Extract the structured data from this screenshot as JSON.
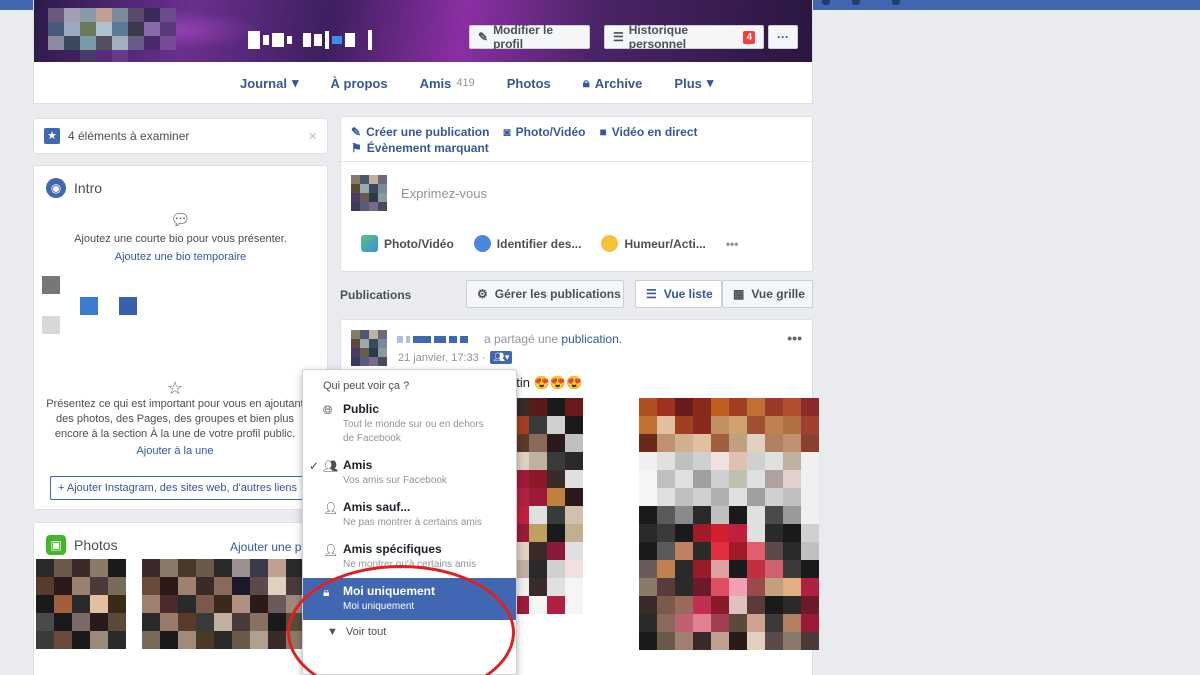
{
  "cover": {
    "edit_profile_label": "Modifier le profil",
    "activity_log_label": "Historique personnel",
    "activity_count": "4",
    "more_label": "···"
  },
  "tabs": [
    {
      "label": "Journal",
      "chevron": "▾"
    },
    {
      "label": "À propos"
    },
    {
      "label": "Amis",
      "count": "419"
    },
    {
      "label": "Photos"
    },
    {
      "label": "Archive",
      "icon": "lock-icon"
    },
    {
      "label": "Plus",
      "chevron": "▾"
    }
  ],
  "notice": {
    "text": "4 éléments à examiner",
    "close": "×"
  },
  "intro": {
    "title": "Intro",
    "bio_prompt": "Ajoutez une courte bio pour vous présenter.",
    "temp_bio_link": "Ajoutez une bio temporaire",
    "featured_text": "Présentez ce qui est important pour vous en ajoutant des photos, des Pages, des groupes et bien plus encore à la section À la une de votre profil public.",
    "featured_link": "Ajouter à la une",
    "add_links_button": "+ Ajouter Instagram, des sites web, d'autres liens"
  },
  "photos": {
    "title": "Photos",
    "add_link": "Ajouter une photo"
  },
  "compose": {
    "create_post": "Créer une publication",
    "photo_video": "Photo/Vidéo",
    "live_video": "Vidéo en direct",
    "life_event": "Évènement marquant",
    "placeholder": "Exprimez-vous",
    "action_photo": "Photo/Vidéo",
    "action_tag": "Identifier des...",
    "action_feeling": "Humeur/Acti...",
    "action_more": "•••"
  },
  "publications": {
    "label": "Publications",
    "manage_label": "Gérer les publications",
    "list_view_label": "Vue liste",
    "grid_view_label": "Vue grille"
  },
  "post": {
    "shared_text": "a partagé une",
    "shared_link": "publication.",
    "date": "21 janvier, 17:33 ·",
    "body_text": "ntin 😍😍😍",
    "more": "•••"
  },
  "privacy_menu": {
    "heading": "Qui peut voir ça ?",
    "options": [
      {
        "title": "Public",
        "desc": "Tout le monde sur ou en dehors de Facebook",
        "icon": "globe-icon",
        "checked": false
      },
      {
        "title": "Amis",
        "desc": "Vos amis sur Facebook",
        "icon": "friends-icon",
        "checked": true
      },
      {
        "title": "Amis sauf...",
        "desc": "Ne pas montrer à certains amis",
        "icon": "person-minus-icon",
        "checked": false
      },
      {
        "title": "Amis spécifiques",
        "desc": "Ne montrer qu'à certains amis",
        "icon": "person-icon",
        "checked": false
      },
      {
        "title": "Moi uniquement",
        "desc": "Moi uniquement",
        "icon": "lock-icon",
        "checked": false,
        "highlighted": true
      }
    ],
    "see_all": "Voir tout"
  },
  "colors": {
    "brand": "#4267b2",
    "link": "#365899",
    "annotation_circle": "#e02020"
  }
}
